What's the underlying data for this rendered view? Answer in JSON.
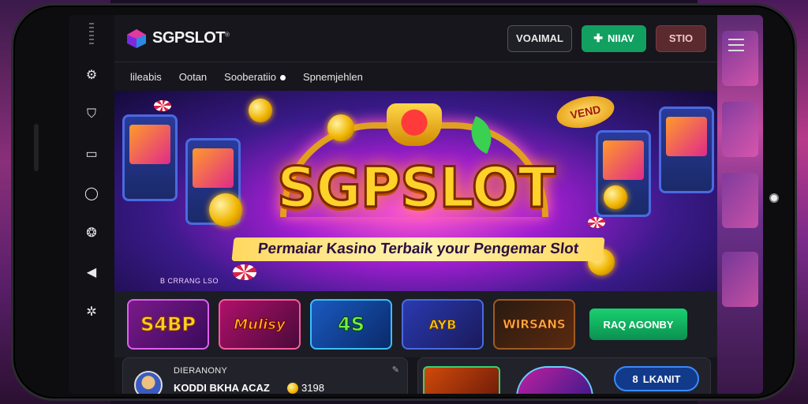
{
  "app": {
    "name": "SGPSLOT",
    "trademark": "®"
  },
  "header": {
    "buttons": {
      "login": "VOAIMAL",
      "register": "NIIAV",
      "register_icon": "plus-icon",
      "extra": "STIO"
    },
    "menu_icon": "hamburger-icon"
  },
  "nav": {
    "items": [
      "lileabis",
      "Ootan",
      "Sooberatiio",
      "Spnemjehlen"
    ]
  },
  "left_rail": {
    "icons": [
      "gear-icon",
      "shield-icon",
      "monitor-icon",
      "chat-icon",
      "settings-circle-icon",
      "play-icon",
      "cog-icon"
    ]
  },
  "hero": {
    "title": "SGPSLOT",
    "subtitle": "Permaiar Kasino Terbaik your Pengemar Slot",
    "badge": "VEND",
    "caption": "B CRRANG LSO"
  },
  "games": {
    "tiles": [
      "S4BP",
      "Mulisy",
      "4S",
      "AYB",
      "WIRSANS"
    ],
    "cta": "RAQ AGONBY"
  },
  "bottom": {
    "user_card": {
      "label": "DIERANONY",
      "value": "KODDI BKHA ACAZ",
      "coins": "3198"
    },
    "cta": "LKANIT",
    "cta_icon_text": "8"
  },
  "colors": {
    "accent_green": "#12a060",
    "accent_red": "#e02a20",
    "hero_gold": "#ffd22a",
    "background": "#1b1b22"
  }
}
